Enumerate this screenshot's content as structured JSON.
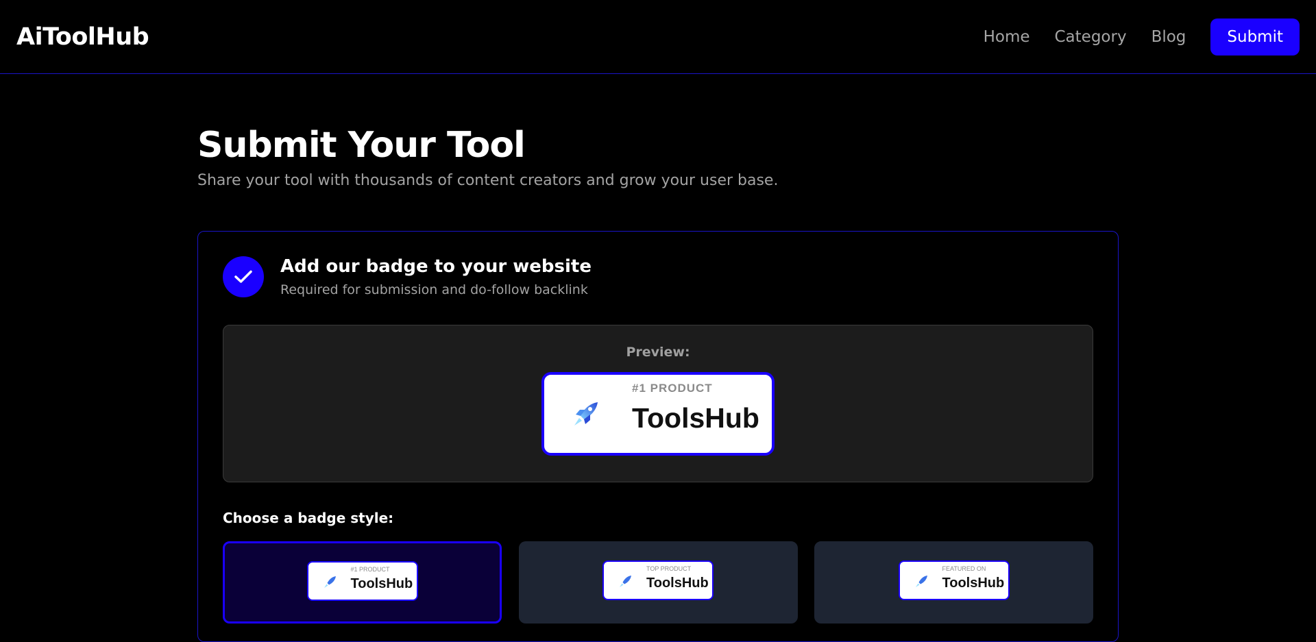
{
  "header": {
    "logo": "AiToolHub",
    "nav": [
      {
        "label": "Home"
      },
      {
        "label": "Category"
      },
      {
        "label": "Blog"
      }
    ],
    "submit_label": "Submit"
  },
  "page": {
    "title": "Submit Your Tool",
    "subtitle": "Share your tool with thousands of content creators and grow your user base."
  },
  "step": {
    "icon": "check-icon",
    "title": "Add our badge to your website",
    "subtitle": "Required for submission and do-follow backlink"
  },
  "preview": {
    "label": "Preview:",
    "badge": {
      "kicker": "#1 PRODUCT",
      "brand": "ToolsHub",
      "icon": "rocket-icon"
    }
  },
  "styles": {
    "label": "Choose a badge style:",
    "options": [
      {
        "kicker": "#1 PRODUCT",
        "brand": "ToolsHub",
        "selected": true
      },
      {
        "kicker": "TOP PRODUCT",
        "brand": "ToolsHub",
        "selected": false
      },
      {
        "kicker": "FEATURED ON",
        "brand": "ToolsHub",
        "selected": false
      }
    ]
  },
  "colors": {
    "accent": "#1a00ff",
    "background": "#000000",
    "panel": "#1c1c1c",
    "option_bg": "#1e2533"
  }
}
